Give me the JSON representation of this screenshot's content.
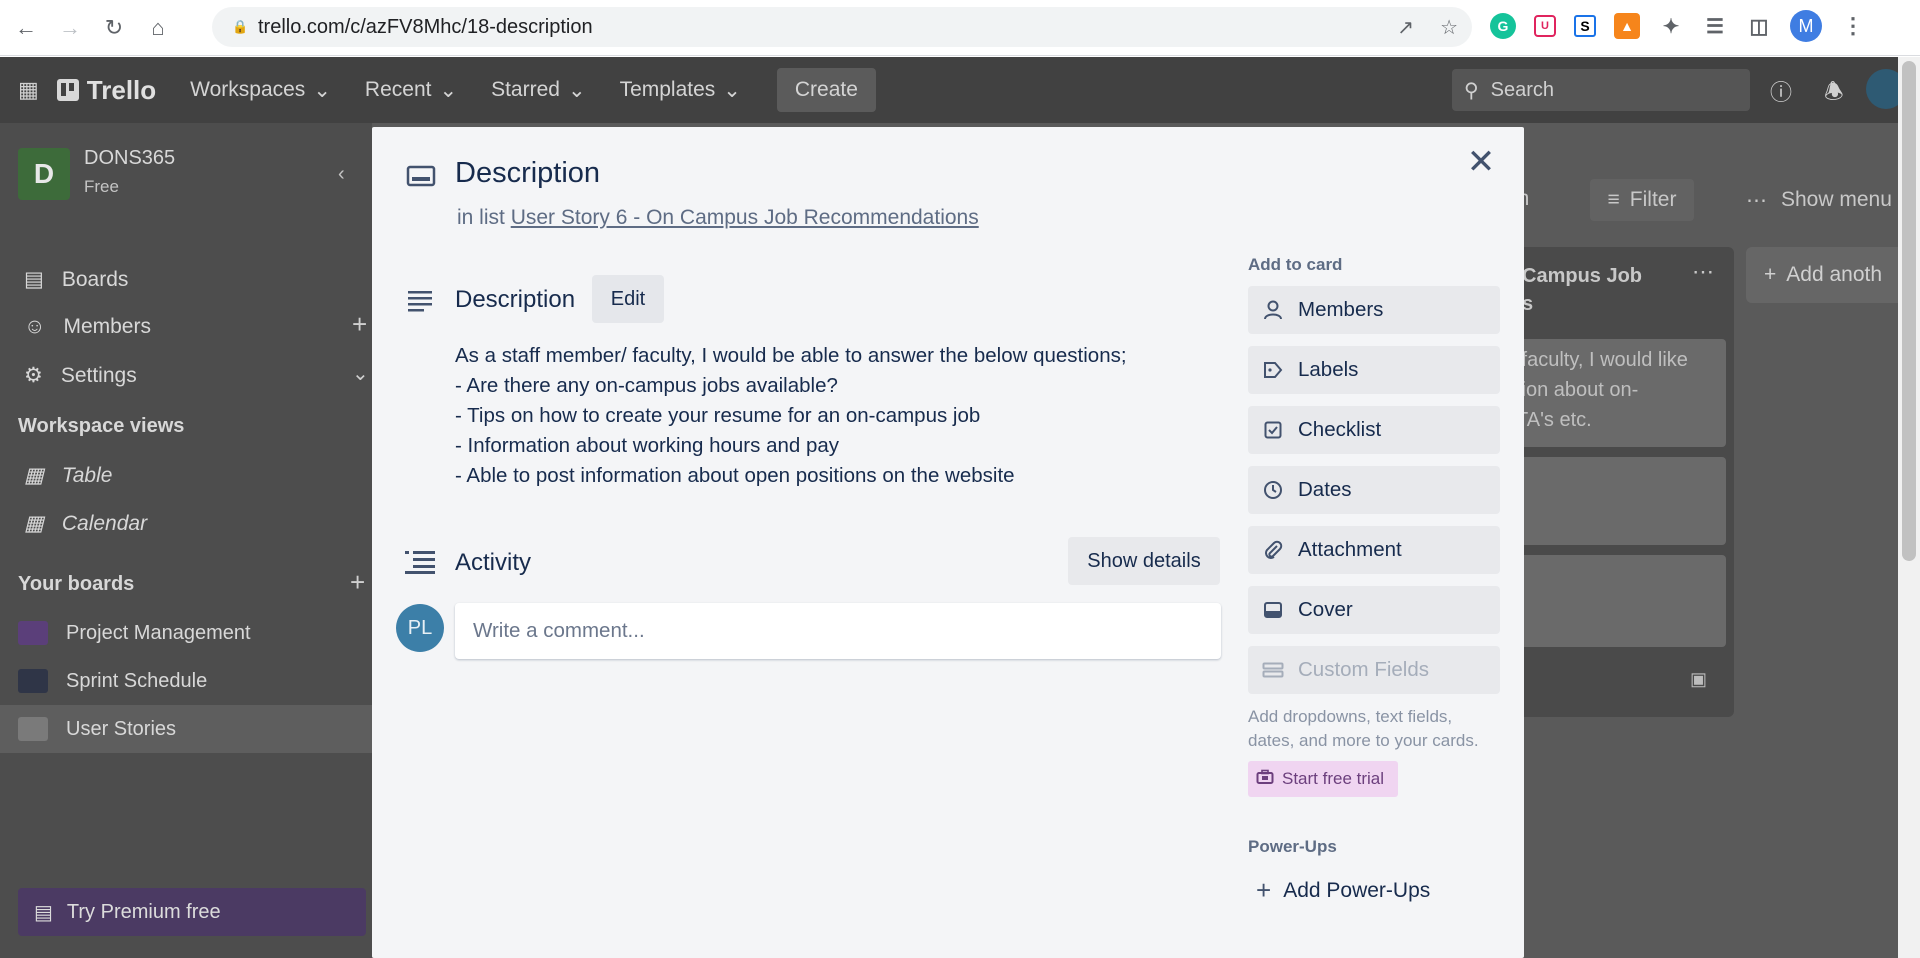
{
  "browser": {
    "url": "trello.com/c/azFV8Mhc/18-description",
    "profile_initial": "M"
  },
  "header": {
    "logo": "Trello",
    "menus": [
      "Workspaces",
      "Recent",
      "Starred",
      "Templates"
    ],
    "create_label": "Create",
    "search_placeholder": "Search"
  },
  "sidebar": {
    "workspace_initial": "D",
    "workspace_name": "DONS365",
    "workspace_plan": "Free",
    "items": [
      {
        "label": "Boards"
      },
      {
        "label": "Members"
      },
      {
        "label": "Settings"
      }
    ],
    "views_heading": "Workspace views",
    "views": [
      {
        "label": "Table"
      },
      {
        "label": "Calendar"
      }
    ],
    "boards_heading": "Your boards",
    "boards": [
      {
        "label": "Project Management",
        "color": "#5b3f7a"
      },
      {
        "label": "Sprint Schedule",
        "color": "#2f3547"
      },
      {
        "label": "User Stories",
        "color": "#7a7a7a"
      }
    ],
    "premium_label": "Try Premium free"
  },
  "board": {
    "filter_label": "Filter",
    "show_menu_label": "Show menu",
    "partial_tab": "on",
    "list_title_partial": "Campus Job",
    "list_title_line2": "s",
    "add_another": "Add anoth",
    "card_text_1": "/faculty, I would like",
    "card_text_2": "tion about on-",
    "card_text_3": "TA's etc."
  },
  "modal": {
    "title": "Description",
    "in_list_prefix": "in list",
    "list_name": "User Story 6 - On Campus Job Recommendations",
    "description_heading": "Description",
    "edit_label": "Edit",
    "description_lines": [
      "As a staff member/ faculty, I would be able to answer the below questions;",
      "- Are there any on-campus jobs available?",
      "- Tips on how to create your resume for an on-campus job",
      "- Information about working hours and pay",
      "- Able to post information about open positions on the website"
    ],
    "activity_heading": "Activity",
    "show_details_label": "Show details",
    "avatar_initials": "PL",
    "comment_placeholder": "Write a comment...",
    "add_to_card_heading": "Add to card",
    "add_to_card_buttons": [
      {
        "label": "Members",
        "icon": "person-icon"
      },
      {
        "label": "Labels",
        "icon": "tag-icon"
      },
      {
        "label": "Checklist",
        "icon": "checkbox-icon"
      },
      {
        "label": "Dates",
        "icon": "clock-icon"
      },
      {
        "label": "Attachment",
        "icon": "paperclip-icon"
      },
      {
        "label": "Cover",
        "icon": "cover-icon"
      },
      {
        "label": "Custom Fields",
        "icon": "fields-icon"
      }
    ],
    "custom_fields_help": "Add dropdowns, text fields, dates, and more to your cards.",
    "start_trial_label": "Start free trial",
    "powerups_heading": "Power-Ups",
    "add_powerups_label": "Add Power-Ups"
  },
  "colors": {
    "modal_bg": "#f4f5f7",
    "text_primary": "#172b4d",
    "text_secondary": "#5e6c84",
    "button_bg": "#e8e9ec",
    "avatar_bg": "#3c7fa8",
    "trial_bg": "#f0d5f1"
  }
}
